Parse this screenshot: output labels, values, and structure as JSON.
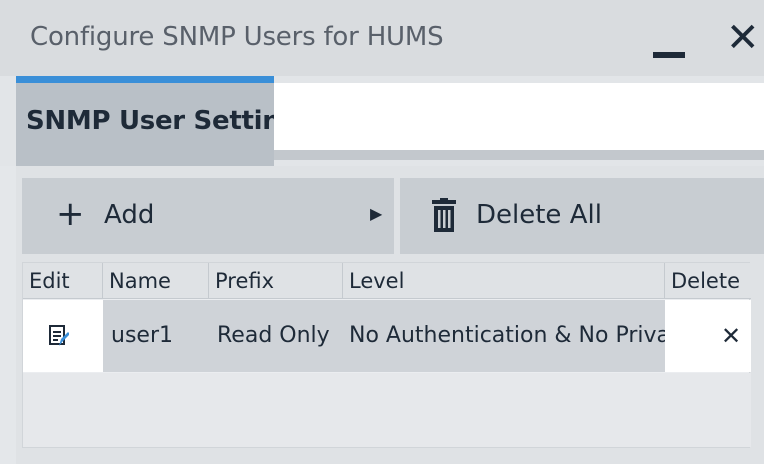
{
  "window": {
    "title": "Configure SNMP Users for HUMS",
    "minimize_glyph": "—",
    "close_glyph": "✕"
  },
  "tabs": [
    {
      "label": "SNMP User Settings",
      "active": true
    }
  ],
  "toolbar": {
    "add_label": "Add",
    "add_icon": "plus-icon",
    "add_submenu_icon": "submenu-arrow-icon",
    "delete_all_label": "Delete All",
    "delete_all_icon": "trash-icon"
  },
  "table": {
    "columns": [
      "Edit",
      "Name",
      "Prefix",
      "Level",
      "Delete"
    ],
    "rows": [
      {
        "edit_icon": "edit-icon",
        "name": "user1",
        "prefix": "Read Only",
        "level": "No Authentication & No Privac",
        "delete_glyph": "✕"
      }
    ]
  },
  "colors": {
    "accent": "#3a8fd8",
    "text": "#1e2a38",
    "title_text": "#59606a",
    "button_bg": "#c8cdd2"
  }
}
